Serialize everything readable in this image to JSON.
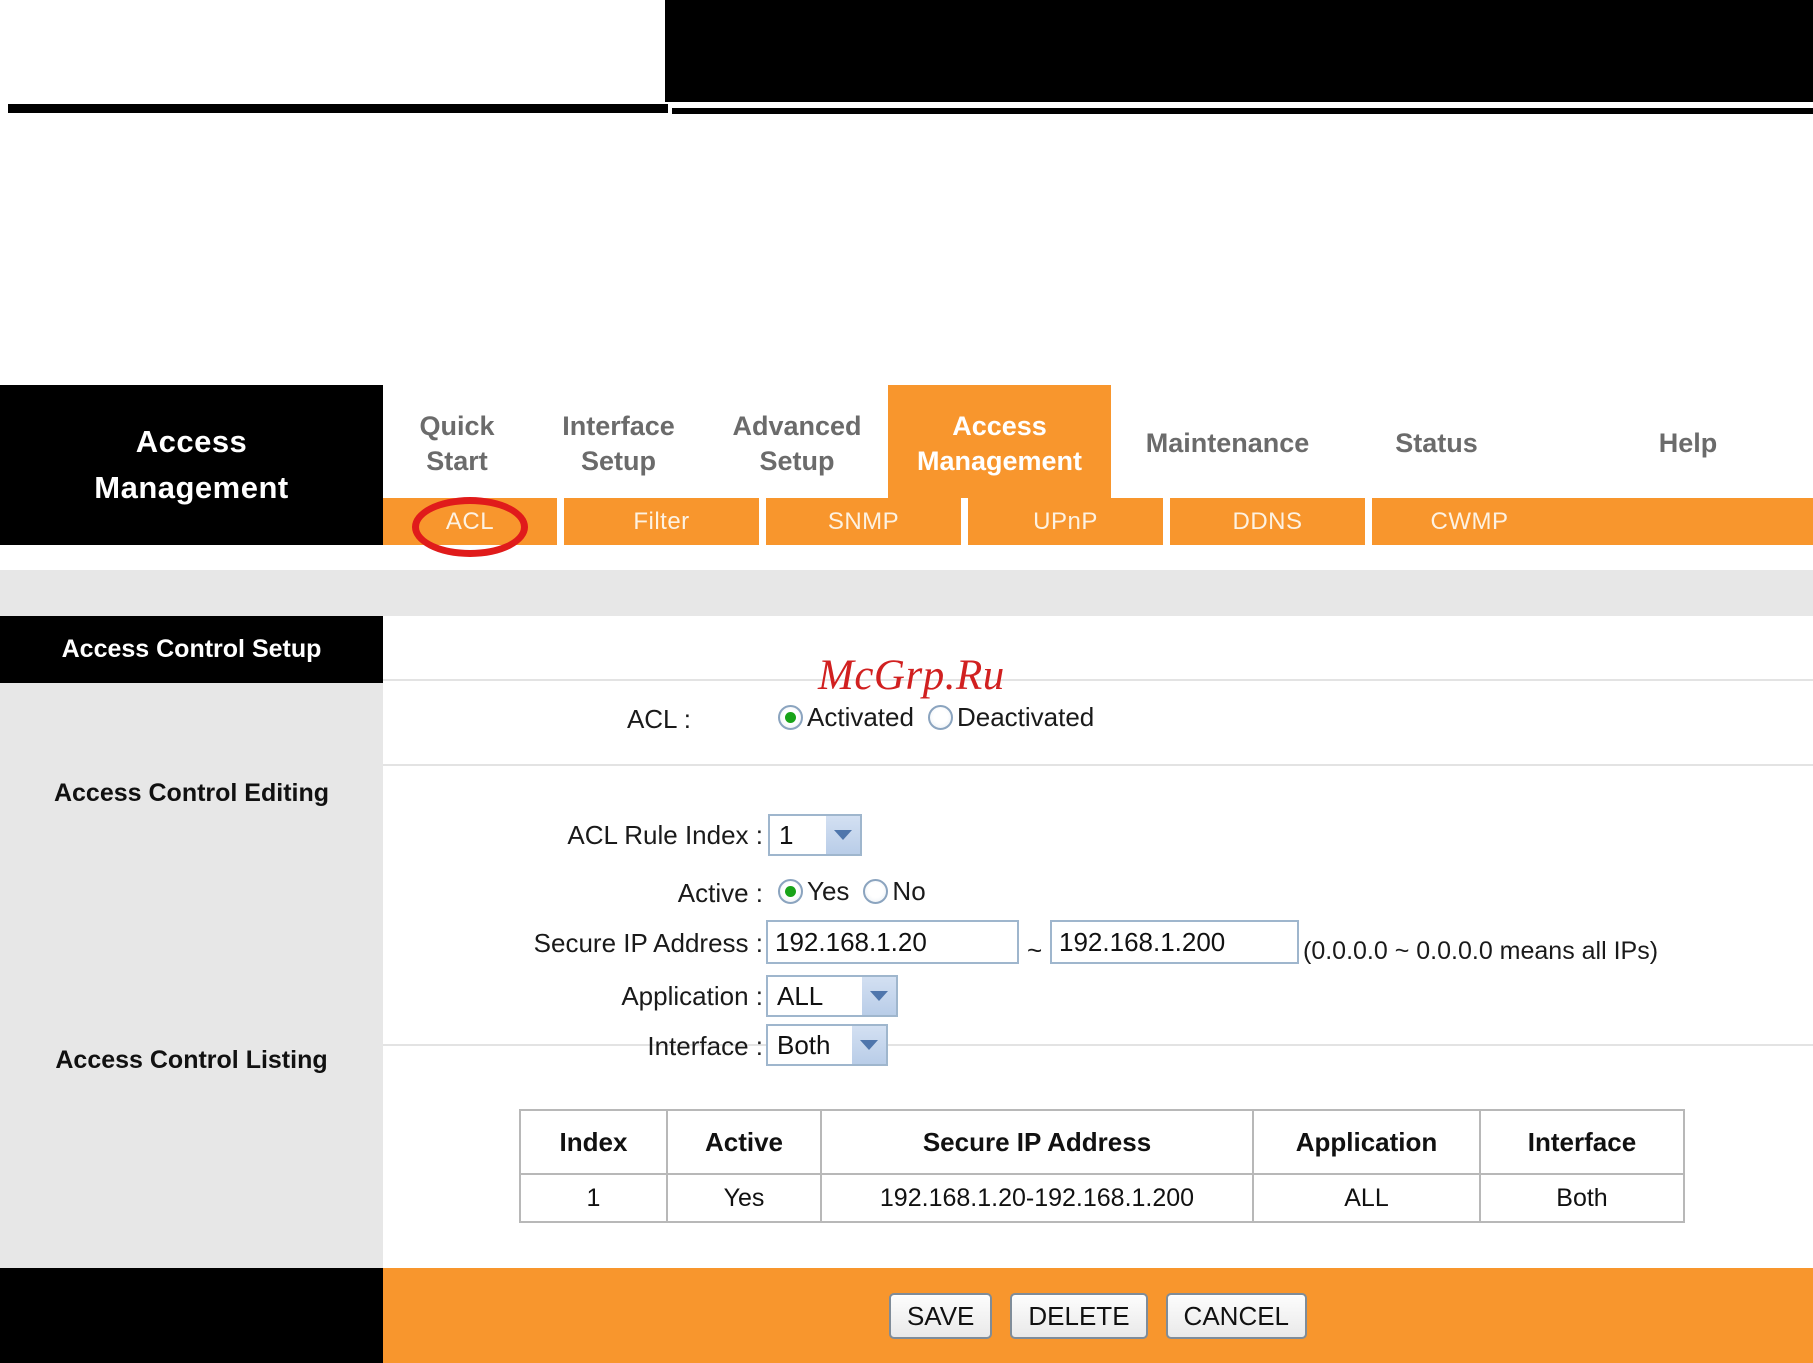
{
  "brand": {
    "line1": "Access",
    "line2": "Management"
  },
  "mainnav": [
    {
      "label1": "Quick",
      "label2": "Start",
      "active": false
    },
    {
      "label1": "Interface",
      "label2": "Setup",
      "active": false
    },
    {
      "label1": "Advanced",
      "label2": "Setup",
      "active": false
    },
    {
      "label1": "Access",
      "label2": "Management",
      "active": true
    },
    {
      "label1": "Maintenance",
      "label2": "",
      "active": false
    },
    {
      "label1": "Status",
      "label2": "",
      "active": false
    },
    {
      "label1": "Help",
      "label2": "",
      "active": false
    }
  ],
  "subnav": [
    {
      "label": "ACL",
      "selected": true
    },
    {
      "label": "Filter",
      "selected": false
    },
    {
      "label": "SNMP",
      "selected": false
    },
    {
      "label": "UPnP",
      "selected": false
    },
    {
      "label": "DDNS",
      "selected": false
    },
    {
      "label": "CWMP",
      "selected": false
    }
  ],
  "sidebar": {
    "header": "Access Control Setup",
    "items": [
      {
        "label": "Access Control Editing"
      },
      {
        "label": "Access Control Listing"
      }
    ]
  },
  "watermark": "McGrp.Ru",
  "form": {
    "acl": {
      "label": "ACL :",
      "options": [
        {
          "label": "Activated",
          "selected": true
        },
        {
          "label": "Deactivated",
          "selected": false
        }
      ]
    },
    "rule_index": {
      "label": "ACL Rule Index :",
      "value": "1"
    },
    "active": {
      "label": "Active :",
      "options": [
        {
          "label": "Yes",
          "selected": true
        },
        {
          "label": "No",
          "selected": false
        }
      ]
    },
    "secure_ip": {
      "label": "Secure IP Address :",
      "from": "192.168.1.20",
      "separator": "~",
      "to": "192.168.1.200",
      "hint": "(0.0.0.0 ~ 0.0.0.0 means all IPs)"
    },
    "application": {
      "label": "Application :",
      "value": "ALL"
    },
    "interface": {
      "label": "Interface :",
      "value": "Both"
    }
  },
  "listing": {
    "columns": [
      "Index",
      "Active",
      "Secure IP Address",
      "Application",
      "Interface"
    ],
    "rows": [
      [
        "1",
        "Yes",
        "192.168.1.20-192.168.1.200",
        "ALL",
        "Both"
      ]
    ]
  },
  "actions": {
    "save": "SAVE",
    "delete": "DELETE",
    "cancel": "CANCEL"
  },
  "colors": {
    "accent_orange": "#f8962d",
    "black": "#000000",
    "grey_band": "#e7e7e7",
    "annotation_red": "#e01b1b",
    "watermark_red": "#d12020",
    "radio_green": "#18a318"
  }
}
